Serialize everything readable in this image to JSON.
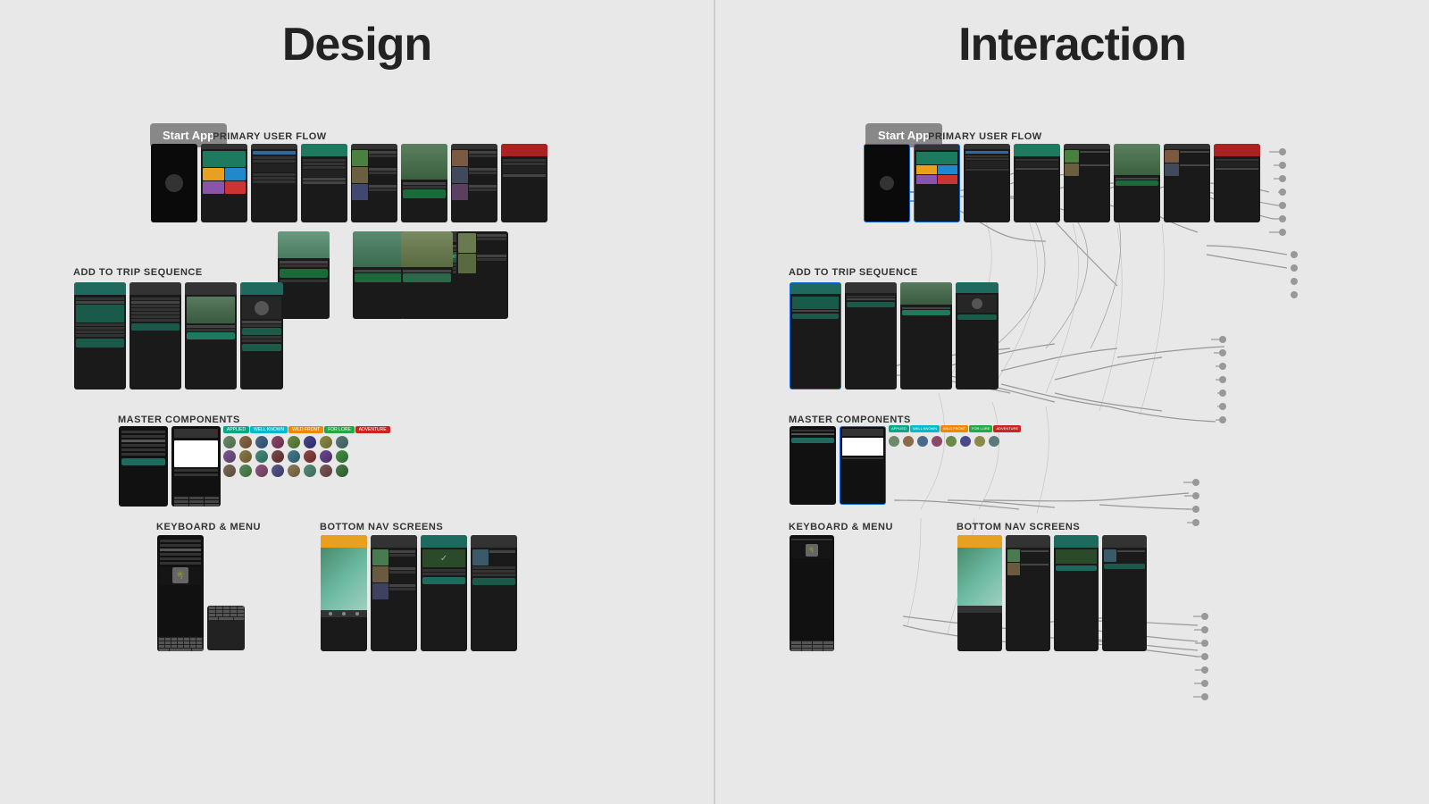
{
  "design": {
    "title": "Design",
    "start_app_label": "Start App",
    "sections": {
      "primary_user_flow": {
        "label": "PRIMARY USER FLOW"
      },
      "add_to_trip": {
        "label": "ADD TO TRIP SEQUENCE"
      },
      "master_components": {
        "label": "MASTER COMPONENTS"
      },
      "keyboard_menu": {
        "label": "KEYBOARD & MENU"
      },
      "bottom_nav": {
        "label": "BOTTOM NAV SCREENS"
      }
    },
    "color_tags": [
      "APPLIED",
      "WELL KNOWN",
      "WILD FRONT",
      "FOR LORE",
      "ADVENTURE"
    ]
  },
  "interaction": {
    "title": "Interaction",
    "start_app_label": "Start App",
    "sections": {
      "primary_user_flow": {
        "label": "PRIMARY USER FLOW"
      },
      "add_to_trip": {
        "label": "ADD TO TRIP SEQUENCE"
      },
      "master_components": {
        "label": "MASTER COMPONENTS"
      },
      "keyboard_menu": {
        "label": "KEYBOARD & MENU"
      },
      "bottom_nav": {
        "label": "BOTTOM NAV SCREENS"
      }
    }
  }
}
